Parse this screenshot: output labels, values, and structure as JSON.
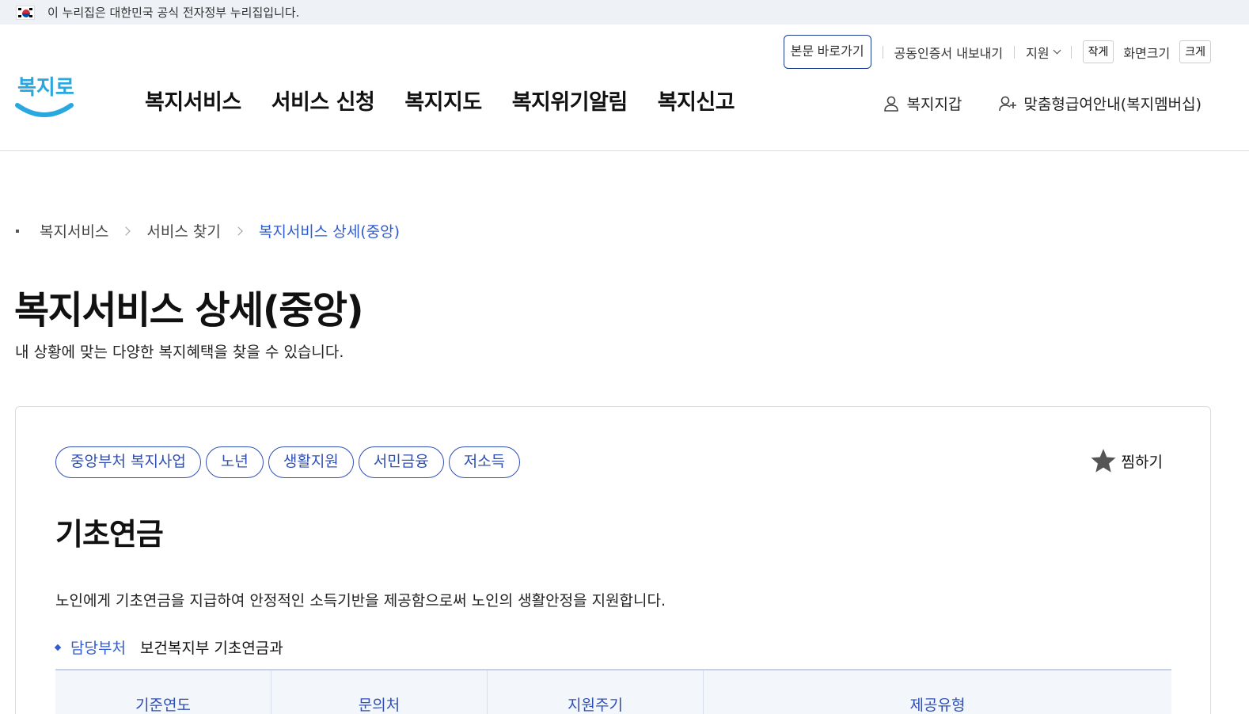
{
  "gov_banner": {
    "text": "이 누리집은 대한민국 공식 전자정부 누리집입니다."
  },
  "logo": {
    "text": "복지로"
  },
  "gnb": {
    "items": [
      "복지서비스",
      "서비스 신청",
      "복지지도",
      "복지위기알림",
      "복지신고"
    ]
  },
  "util": {
    "skip_label": "본문 바로가기",
    "cert_label": "공동인증서 내보내기",
    "support_label": "지원",
    "small_label": "작게",
    "screen_size_label": "화면크기",
    "large_label": "크게"
  },
  "user_menu": {
    "wallet_label": "복지지갑",
    "membership_label": "맞춤형급여안내(복지멤버십)"
  },
  "breadcrumb": {
    "items": [
      "복지서비스",
      "서비스 찾기",
      "복지서비스 상세(중앙)"
    ]
  },
  "page": {
    "title": "복지서비스 상세(중앙)",
    "description": "내 상황에 맞는 다양한 복지혜택을 찾을 수 있습니다."
  },
  "service": {
    "tags": [
      "중앙부처 복지사업",
      "노년",
      "생활지원",
      "서민금융",
      "저소득"
    ],
    "favorite_label": "찜하기",
    "title": "기초연금",
    "description": "노인에게 기초연금을 지급하여 안정적인 소득기반을 제공함으로써 노인의 생활안정을 지원합니다.",
    "dept_label": "담당부처",
    "dept_value": "보건복지부 기초연금과",
    "table_headers": [
      "기준연도",
      "문의처",
      "지원주기",
      "제공유형"
    ]
  },
  "colors": {
    "accent": "#2f5bd3",
    "tag_border": "#2f4fb5",
    "logo": "#29a8e0"
  }
}
